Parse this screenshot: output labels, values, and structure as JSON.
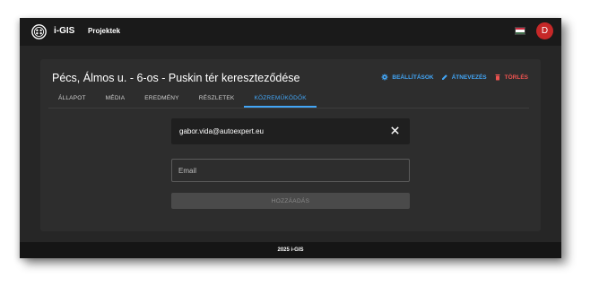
{
  "appbar": {
    "brand": "i-GIS",
    "nav_link": "Projektek",
    "avatar_initial": "D",
    "flag_colors": [
      "#cd2a3e",
      "#ffffff",
      "#436f4d"
    ]
  },
  "project": {
    "title": "Pécs, Álmos u. - 6-os - Puskin tér kereszteződése"
  },
  "actions": {
    "settings": {
      "label": "BEÁLLÍTÁSOK",
      "icon": "gear-icon",
      "color": "#42a5f5"
    },
    "rename": {
      "label": "ÁTNEVEZÉS",
      "icon": "pencil-icon",
      "color": "#42a5f5"
    },
    "delete": {
      "label": "TÖRLÉS",
      "icon": "trash-icon",
      "color": "#ef5350"
    }
  },
  "tabs": [
    {
      "label": "ÁLLAPOT"
    },
    {
      "label": "MÉDIA"
    },
    {
      "label": "EREDMÉNY"
    },
    {
      "label": "RÉSZLETEK"
    },
    {
      "label": "KÖZREMŰKÖDŐK",
      "active": true
    }
  ],
  "collaborators": {
    "members": [
      {
        "email": "gabor.vida@autoexpert.eu"
      }
    ],
    "email_field": {
      "value": "",
      "placeholder": "Email"
    },
    "add_button_label": "HOZZÁADÁS"
  },
  "footer": {
    "text": "2025 i-GIS"
  }
}
